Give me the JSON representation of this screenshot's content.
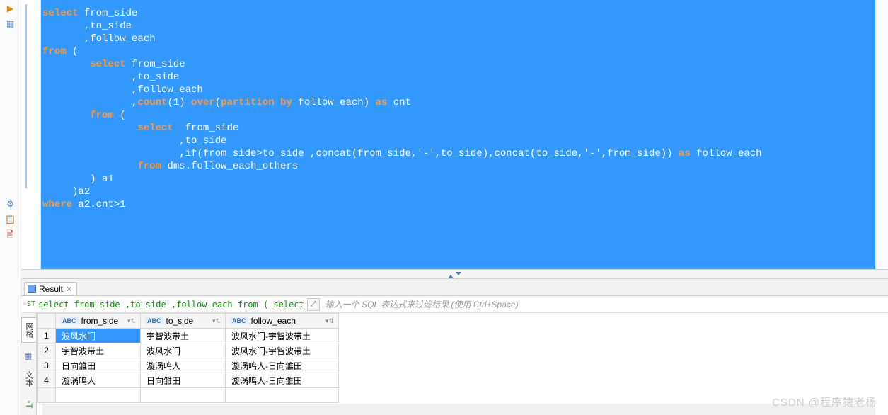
{
  "gutter": {
    "icons": [
      "run-icon",
      "table-icon",
      "gear-icon",
      "paste-icon",
      "script-icon"
    ]
  },
  "sql": {
    "lines": [
      [
        [
          "kw",
          "select"
        ],
        [
          "",
          " from_side"
        ]
      ],
      [
        [
          "",
          "       ,to_side"
        ]
      ],
      [
        [
          "",
          "       ,follow_each"
        ]
      ],
      [
        [
          "kw",
          "from"
        ],
        [
          "",
          " ("
        ]
      ],
      [
        [
          "",
          "        "
        ],
        [
          "kw",
          "select"
        ],
        [
          "",
          " from_side"
        ]
      ],
      [
        [
          "",
          "               ,to_side"
        ]
      ],
      [
        [
          "",
          "               ,follow_each"
        ]
      ],
      [
        [
          "",
          "               ,"
        ],
        [
          "kw",
          "count"
        ],
        [
          "",
          "(1) "
        ],
        [
          "kw",
          "over"
        ],
        [
          "",
          "("
        ],
        [
          "kw",
          "partition by"
        ],
        [
          "",
          " follow_each) "
        ],
        [
          "kw",
          "as"
        ],
        [
          "",
          " cnt"
        ]
      ],
      [
        [
          "",
          "        "
        ],
        [
          "kw",
          "from"
        ],
        [
          "",
          " ("
        ]
      ],
      [
        [
          "",
          "                "
        ],
        [
          "kw",
          "select"
        ],
        [
          "",
          "  from_side"
        ]
      ],
      [
        [
          "",
          "                       ,to_side"
        ]
      ],
      [
        [
          "",
          "                       ,if(from_side>to_side ,concat(from_side,'-',to_side),concat(to_side,'-',from_side)) "
        ],
        [
          "kw",
          "as"
        ],
        [
          "",
          " follow_each"
        ]
      ],
      [
        [
          "",
          "                "
        ],
        [
          "kw",
          "from"
        ],
        [
          "",
          " dms.follow_each_others"
        ]
      ],
      [
        [
          "",
          "        ) a1"
        ]
      ],
      [
        [
          "",
          "     )a2"
        ]
      ],
      [
        [
          "kw",
          "where"
        ],
        [
          "",
          " a2.cnt>1"
        ]
      ]
    ]
  },
  "result": {
    "tab_label": "Result",
    "filter_sql": "select from_side ,to_side ,follow_each from ( select",
    "filter_placeholder": "输入一个 SQL 表达式来过滤结果 (使用 Ctrl+Space)",
    "side_tabs": {
      "grid": "网格",
      "text": "文本"
    },
    "columns": [
      "from_side",
      "to_side",
      "follow_each"
    ],
    "type_badge": "ABC",
    "rows": [
      {
        "n": "1",
        "c": [
          "波风水门",
          "宇智波带土",
          "波风水门-宇智波带土"
        ],
        "selected": 0
      },
      {
        "n": "2",
        "c": [
          "宇智波带土",
          "波风水门",
          "波风水门-宇智波带土"
        ]
      },
      {
        "n": "3",
        "c": [
          "日向雏田",
          "漩涡鸣人",
          "漩涡鸣人-日向雏田"
        ]
      },
      {
        "n": "4",
        "c": [
          "漩涡鸣人",
          "日向雏田",
          "漩涡鸣人-日向雏田"
        ]
      }
    ]
  },
  "watermark": "CSDN @程序猿老杨"
}
